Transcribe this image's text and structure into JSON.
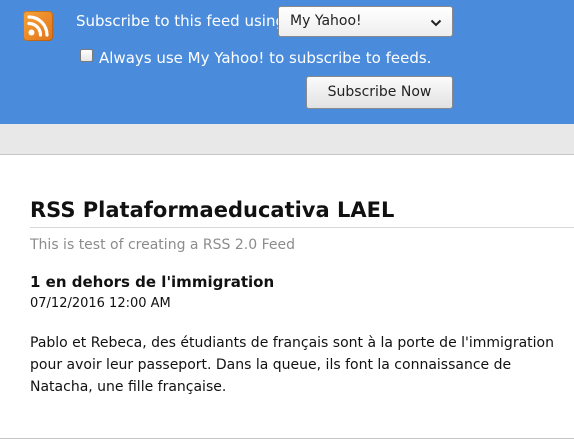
{
  "subscribe": {
    "label": "Subscribe to this feed using",
    "reader_selected": "My Yahoo!",
    "always_label": "Always use My Yahoo! to subscribe to feeds.",
    "always_checked": false,
    "button_label": "Subscribe Now",
    "icon": "rss-icon",
    "bar_color": "#4a8cdb"
  },
  "feed": {
    "title": "RSS Plataformaeducativa LAEL",
    "subtitle": "This is test of creating a RSS 2.0 Feed"
  },
  "entries": [
    {
      "title": "1 en dehors de l'immigration",
      "date": "07/12/2016 12:00 AM",
      "body": "Pablo et Rebeca, des étudiants de français sont à la porte de l'immigration pour avoir leur passeport. Dans la queue, ils font la connaissance de Natacha, une fille française."
    }
  ]
}
